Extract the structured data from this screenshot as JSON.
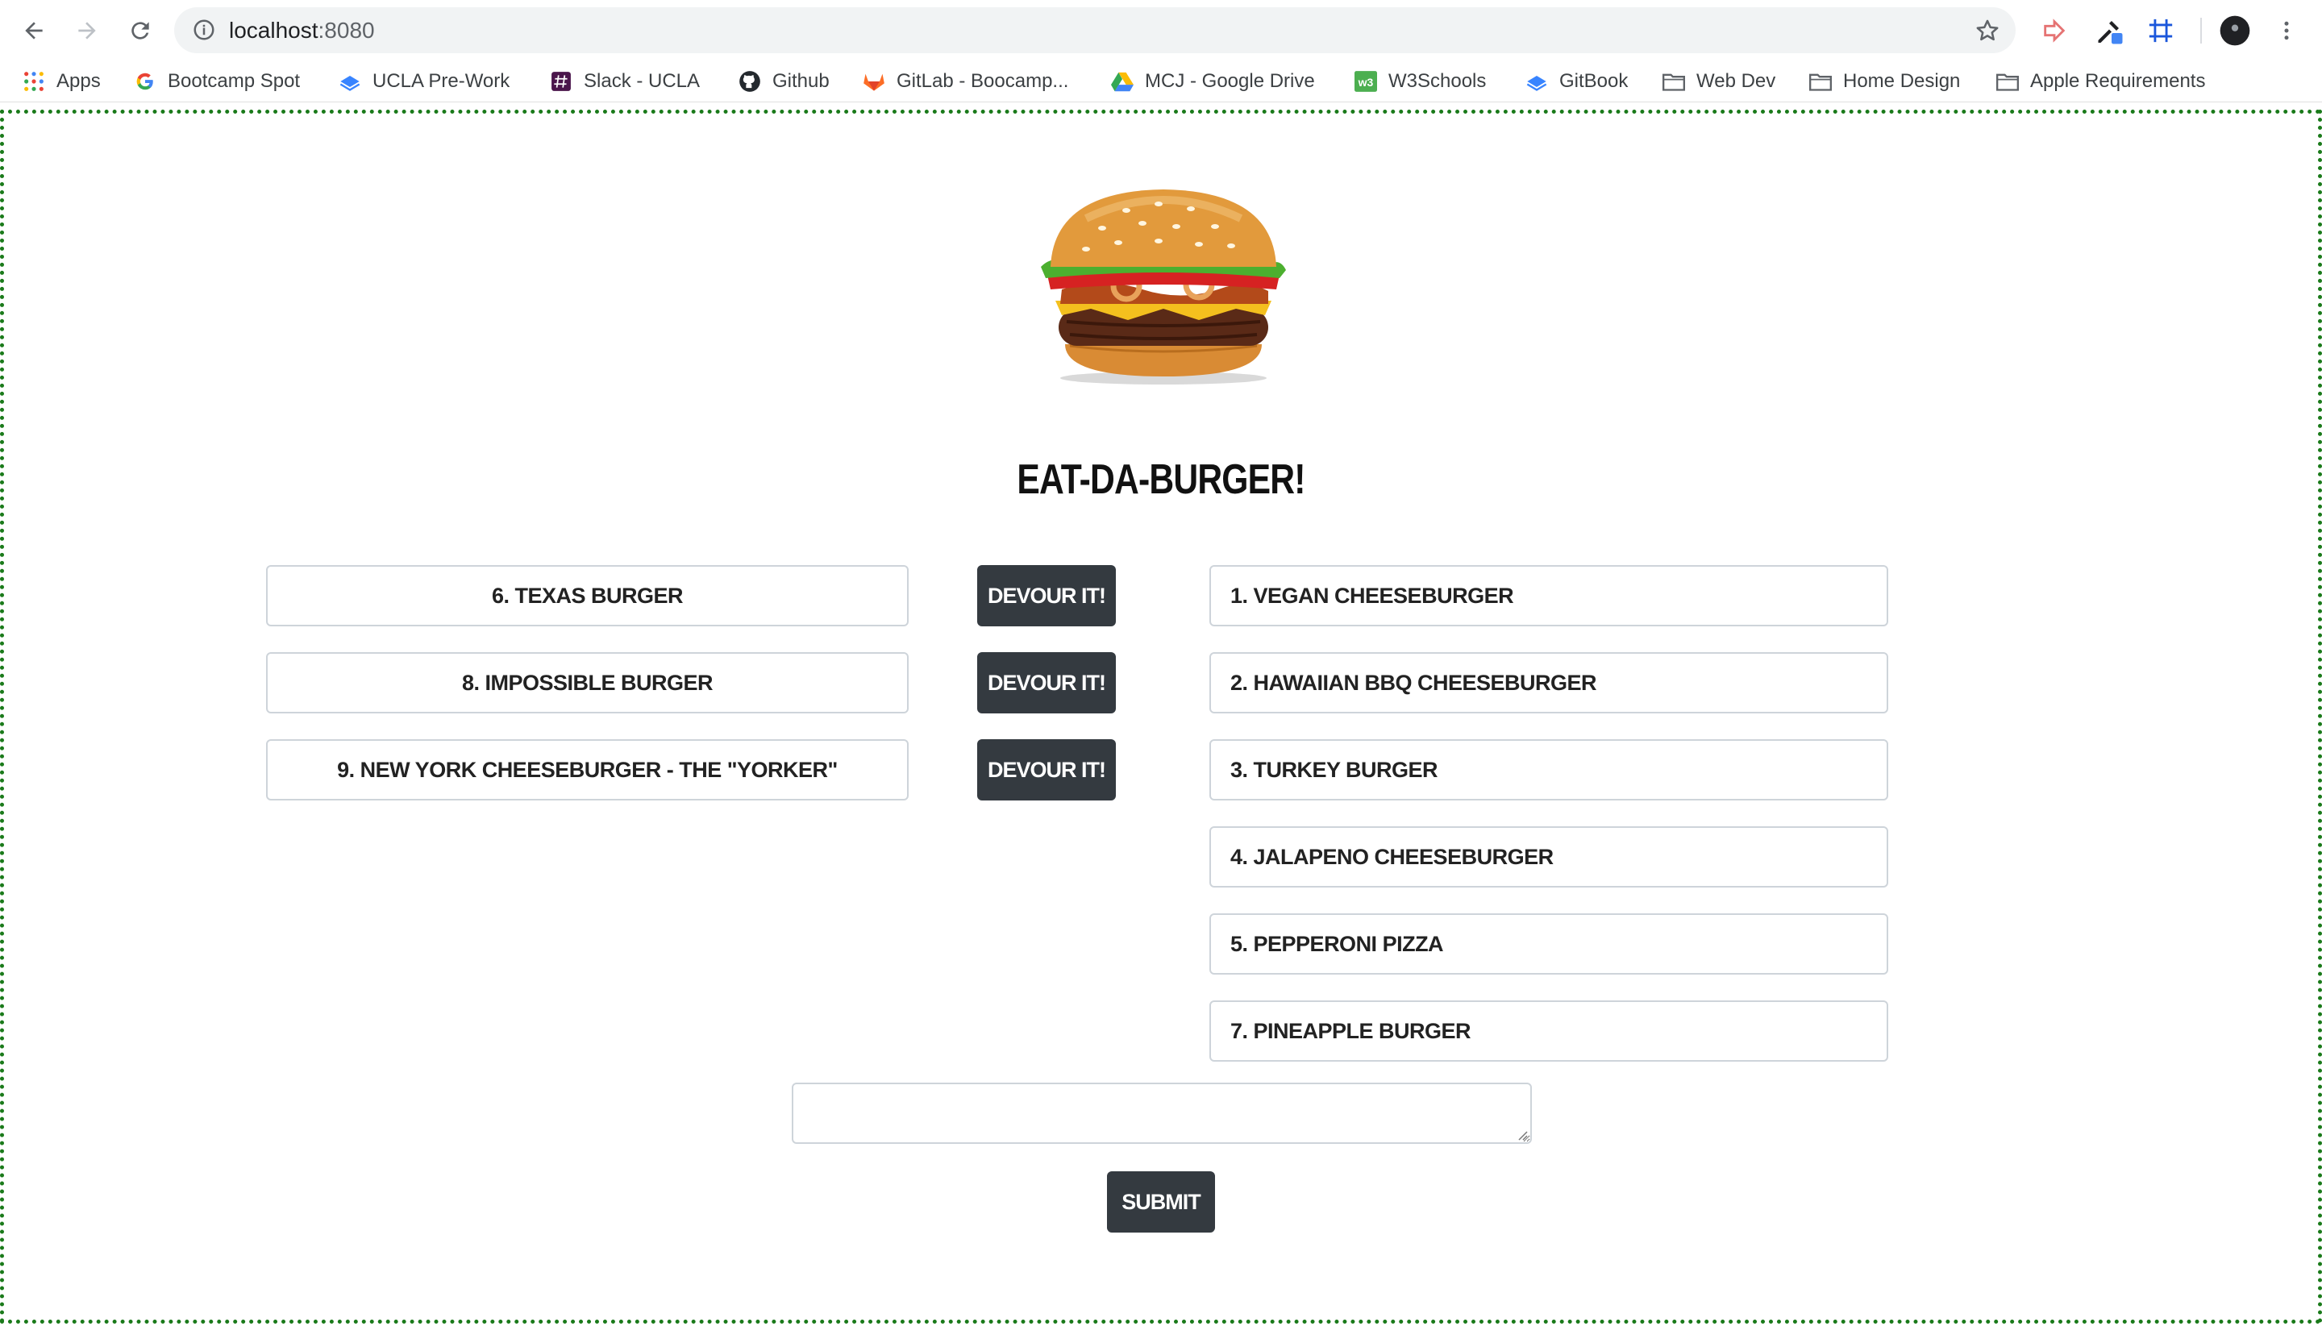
{
  "browser": {
    "url_host": "localhost",
    "url_port": ":8080"
  },
  "bookmarks": [
    {
      "label": "Apps",
      "icon": "apps-grid-icon"
    },
    {
      "label": "Bootcamp Spot",
      "icon": "google-icon"
    },
    {
      "label": "UCLA Pre-Work",
      "icon": "gitbook-icon"
    },
    {
      "label": "Slack - UCLA",
      "icon": "slack-icon"
    },
    {
      "label": "Github",
      "icon": "github-icon"
    },
    {
      "label": "GitLab - Boocamp...",
      "icon": "gitlab-icon"
    },
    {
      "label": "MCJ - Google Drive",
      "icon": "google-drive-icon"
    },
    {
      "label": "W3Schools",
      "icon": "w3schools-icon"
    },
    {
      "label": "GitBook",
      "icon": "gitbook-icon"
    },
    {
      "label": "Web Dev",
      "icon": "folder-icon"
    },
    {
      "label": "Home Design",
      "icon": "folder-icon"
    },
    {
      "label": "Apple Requirements",
      "icon": "folder-icon"
    }
  ],
  "page": {
    "title": "EAT-DA-BURGER!",
    "devour_label": "DEVOUR IT!",
    "uneaten": [
      "6. TEXAS BURGER",
      "8. IMPOSSIBLE BURGER",
      "9. NEW YORK CHEESEBURGER - THE \"YORKER\""
    ],
    "devoured": [
      "1. VEGAN CHEESEBURGER",
      "2. HAWAIIAN BBQ CHEESEBURGER",
      "3. TURKEY BURGER",
      "4. JALAPENO CHEESEBURGER",
      "5. PEPPERONI PIZZA",
      "7. PINEAPPLE BURGER"
    ],
    "new_burger_value": "",
    "submit_label": "SUBMIT"
  },
  "colors": {
    "button_dark": "#343a40",
    "viewport_border": "#1a7a1a"
  }
}
